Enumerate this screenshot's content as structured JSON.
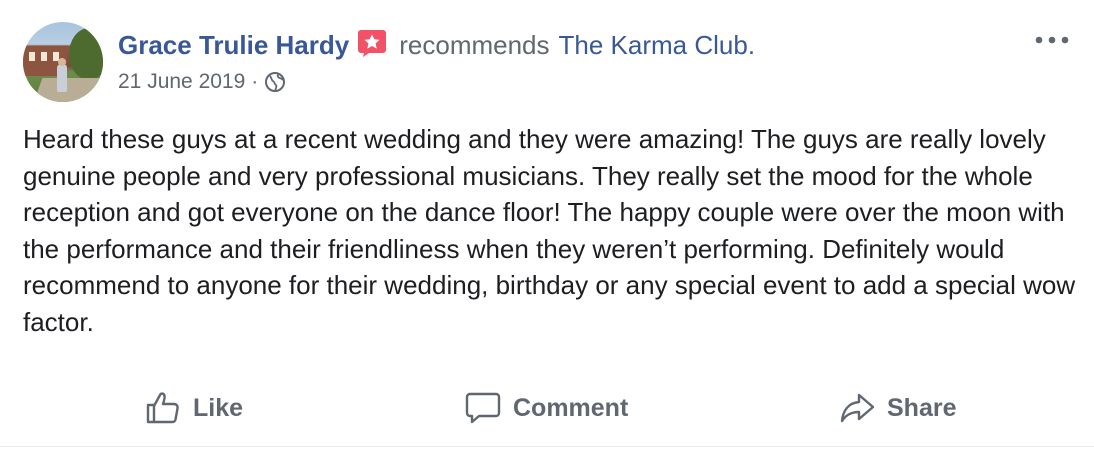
{
  "post": {
    "author": "Grace Trulie Hardy",
    "action_text": "recommends",
    "page_name": "The Karma Club.",
    "date": "21 June 2019",
    "separator": "·",
    "audience_icon": "globe-icon",
    "badge_icon": "star-badge-icon",
    "more_icon": "more-options-icon",
    "body": "Heard these guys at a recent wedding and they were amazing! The guys are really lovely genuine people and very professional musicians. They really set the mood for the whole reception and got everyone on the dance floor! The happy couple were over the moon with the performance and their friendliness when they weren’t performing. Definitely would recommend to anyone for their wedding, birthday or any special event to add a special wow factor."
  },
  "actions": {
    "like": {
      "label": "Like",
      "icon": "thumbs-up-icon"
    },
    "comment": {
      "label": "Comment",
      "icon": "comment-icon"
    },
    "share": {
      "label": "Share",
      "icon": "share-arrow-icon"
    }
  },
  "colors": {
    "link_blue": "#385898",
    "secondary_gray": "#606770",
    "text": "#1c1e21",
    "badge_pink": "#f25268"
  }
}
